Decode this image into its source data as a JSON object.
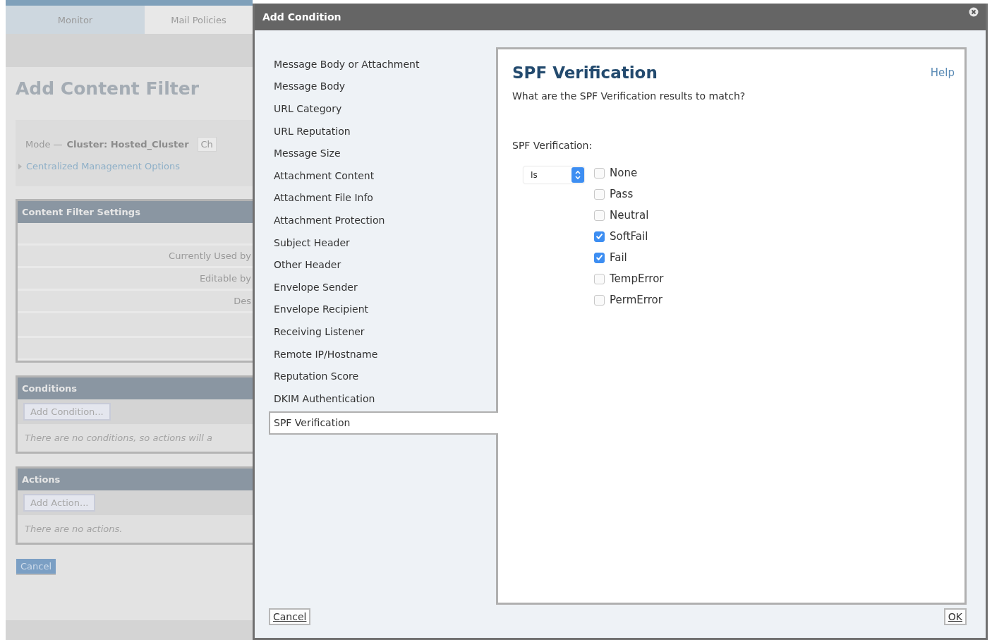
{
  "background_page": {
    "tabs": [
      {
        "label": "Monitor",
        "selected": true
      },
      {
        "label": "Mail Policies",
        "selected": false
      }
    ],
    "title": "Add Content Filter",
    "mode": {
      "label": "Mode —",
      "value": "Cluster: Hosted_Cluster",
      "button": "Ch"
    },
    "centralized_link": "Centralized Management Options",
    "settings_panel": {
      "title": "Content Filter Settings",
      "row_labels": [
        "Currently Used by",
        "Editable by",
        "Des"
      ]
    },
    "conditions": {
      "title": "Conditions",
      "button": "Add Condition...",
      "empty_text": "There are no conditions, so actions will a"
    },
    "actions": {
      "title": "Actions",
      "button": "Add Action...",
      "empty_text": "There are no actions."
    },
    "cancel_button": "Cancel"
  },
  "dialog": {
    "title": "Add Condition",
    "categories": [
      {
        "label": "Message Body or Attachment",
        "selected": false
      },
      {
        "label": "Message Body",
        "selected": false
      },
      {
        "label": "URL Category",
        "selected": false
      },
      {
        "label": "URL Reputation",
        "selected": false
      },
      {
        "label": "Message Size",
        "selected": false
      },
      {
        "label": "Attachment Content",
        "selected": false
      },
      {
        "label": "Attachment File Info",
        "selected": false
      },
      {
        "label": "Attachment Protection",
        "selected": false
      },
      {
        "label": "Subject Header",
        "selected": false
      },
      {
        "label": "Other Header",
        "selected": false
      },
      {
        "label": "Envelope Sender",
        "selected": false
      },
      {
        "label": "Envelope Recipient",
        "selected": false
      },
      {
        "label": "Receiving Listener",
        "selected": false
      },
      {
        "label": "Remote IP/Hostname",
        "selected": false
      },
      {
        "label": "Reputation Score",
        "selected": false
      },
      {
        "label": "DKIM Authentication",
        "selected": false
      },
      {
        "label": "SPF Verification",
        "selected": true
      }
    ],
    "panel": {
      "heading": "SPF Verification",
      "help": "Help",
      "question": "What are the SPF Verification results to match?",
      "field_label": "SPF Verification:",
      "operator": "Is",
      "options": [
        {
          "label": "None",
          "checked": false
        },
        {
          "label": "Pass",
          "checked": false
        },
        {
          "label": "Neutral",
          "checked": false
        },
        {
          "label": "SoftFail",
          "checked": true
        },
        {
          "label": "Fail",
          "checked": true
        },
        {
          "label": "TempError",
          "checked": false
        },
        {
          "label": "PermError",
          "checked": false
        }
      ]
    },
    "cancel_button": "Cancel",
    "ok_button": "OK"
  }
}
